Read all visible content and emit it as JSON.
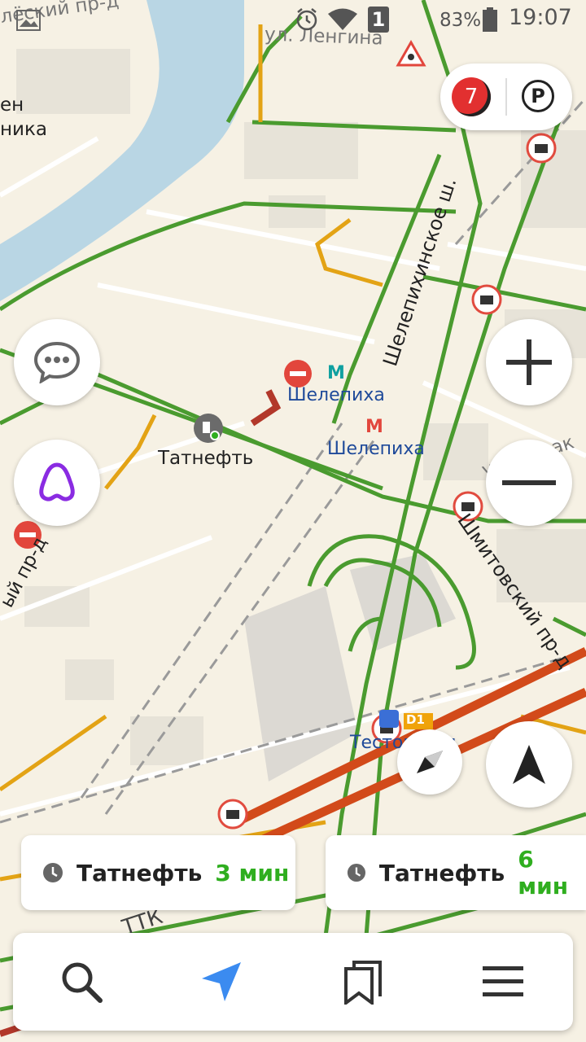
{
  "status_bar": {
    "battery_percent": "83%",
    "time": "19:07",
    "sim_slot": "1",
    "icons": [
      "image-icon",
      "alarm-icon",
      "wifi-icon",
      "sim-icon",
      "battery-icon"
    ]
  },
  "map": {
    "street_labels": {
      "top_left_street": "лёский пр-д",
      "top_street": "ул. Ленгина",
      "left_fragment_1": "ен",
      "left_fragment_2": "ника",
      "shelepikhinskoe": "Шелепихинское ш.",
      "shmitovsky": "Шмитовский пр-д",
      "ermak": "ул. Ермак",
      "left_vertical": "ый пр-д",
      "ttk": "ТТК"
    },
    "poi_labels": {
      "metro_1": "Шелепиха",
      "metro_2": "Шелепиха",
      "gas_station": "Татнефть",
      "station_3": "Тестовская",
      "d1_badge": "D1"
    },
    "colors": {
      "water": "#b9d6e4",
      "land": "#f6f1e4",
      "traffic_green": "#4a9b2f",
      "traffic_yellow": "#e3a315",
      "traffic_red": "#d24a1a",
      "accent_blue": "#3b8bf0",
      "alice_purple": "#8a2be2"
    }
  },
  "controls": {
    "traffic_score": "7",
    "parking_label": "P"
  },
  "route_cards": [
    {
      "destination": "Татнефть",
      "time": "3 мин"
    },
    {
      "destination": "Татнефть",
      "time": "6 мин"
    }
  ],
  "bottom_nav": [
    {
      "name": "search",
      "icon": "search-icon"
    },
    {
      "name": "navigation",
      "icon": "navigation-arrow-icon"
    },
    {
      "name": "bookmarks",
      "icon": "bookmarks-icon"
    },
    {
      "name": "menu",
      "icon": "menu-icon"
    }
  ]
}
